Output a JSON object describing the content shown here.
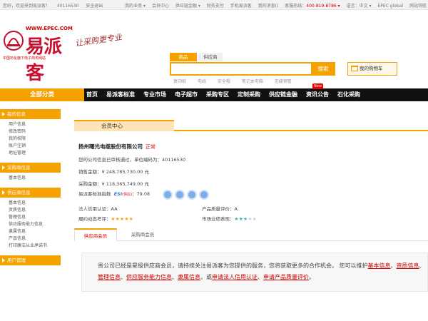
{
  "topbar": {
    "welcome": "您好，欢迎来到易派客！",
    "account_id": "40116530",
    "logout": "安全退出",
    "links": [
      "我的业务 ▾",
      "会员中心",
      "供应链金融 ▾",
      "财务支付",
      "手机易派客",
      "我的消息()",
      "客服热线："
    ],
    "hotline": "400-819-8786 ▾",
    "language": "语言：中文 ▾",
    "global": "EPEC global",
    "sitemap": "网站导航"
  },
  "logo": {
    "url_text": "WWW.EPEC.COM",
    "brand": "易派客",
    "sub": "中国石化旗下电子商务网站",
    "slogan": "让采购更专业"
  },
  "search": {
    "tab_goods": "商品",
    "tab_supplier": "供应商",
    "placeholder": "",
    "button": "搜索",
    "hot_words": [
      "复印纸",
      "电线",
      "安全帽",
      "笔记本电脑",
      "无缝钢管"
    ]
  },
  "cart": {
    "label": "我的购物车"
  },
  "nav": {
    "all_categories": "全部分类",
    "items": [
      "首页",
      "易派客标准",
      "专业市场",
      "电子超市",
      "采购专区",
      "定制采购",
      "供应链金融",
      "资讯公告",
      "石化采购"
    ],
    "badge": "New"
  },
  "sidebar": {
    "groups": [
      {
        "title": "我的信息",
        "items": [
          "用户信息",
          "修改密码",
          "我的权限",
          "账户注销",
          "地址管理"
        ]
      },
      {
        "title": "采购商信息",
        "items": [
          "基本信息"
        ]
      },
      {
        "title": "供应商信息",
        "items": [
          "基本信息",
          "资质信息",
          "管理信息",
          "供应服务能力信息",
          "隶属信息",
          "产品信息",
          "打印廉洁从业承诺书"
        ]
      },
      {
        "title": "用户管理",
        "items": []
      }
    ]
  },
  "member": {
    "title": "会员中心",
    "company_name": "扬州曙光电缆股份有限公司",
    "status": "正常",
    "audit_text": "您的公司信息已审核通过，单位编码为：40116530",
    "sales_label": "销售金额：",
    "sales_value": "¥ 248,785,730.00 元",
    "purchase_label": "采购金额：",
    "purchase_value": "¥ 118,365,749.00 元",
    "index_label": "易派客标准指数",
    "esi": "ESI",
    "esi_note": "(供应)",
    "esi_value": "：79.08",
    "credit_label": "法人信用认证：AA",
    "quality_label": "产品质量评价：A",
    "fulfil_label": "履约动态考评：",
    "market_label": "市场业绩表现：",
    "fulfil_stars": 5,
    "market_stars": 3
  },
  "tabs": {
    "supplier": "供应商会员",
    "purchaser": "采购商会员"
  },
  "notice": {
    "line1_pre": "贵公司已经是星级供应商会员，请持续关注易派客为您提供的服务，您将获取更多的合作机会。 您可以维护",
    "link_basic": "基本信息",
    "sep1": "、",
    "link_qual": "资质",
    "link_qual2": "信息",
    "sep2": "、",
    "link_mgmt": "管理信息",
    "sep3": "、",
    "link_service": "供应服务能力信息",
    "sep4": "、",
    "link_affil": "隶属信息",
    "mid": "，或",
    "link_credit": "申请法人信用认证",
    "sep5": "、",
    "link_quality": "申请产品质量评价",
    "end": "。"
  }
}
